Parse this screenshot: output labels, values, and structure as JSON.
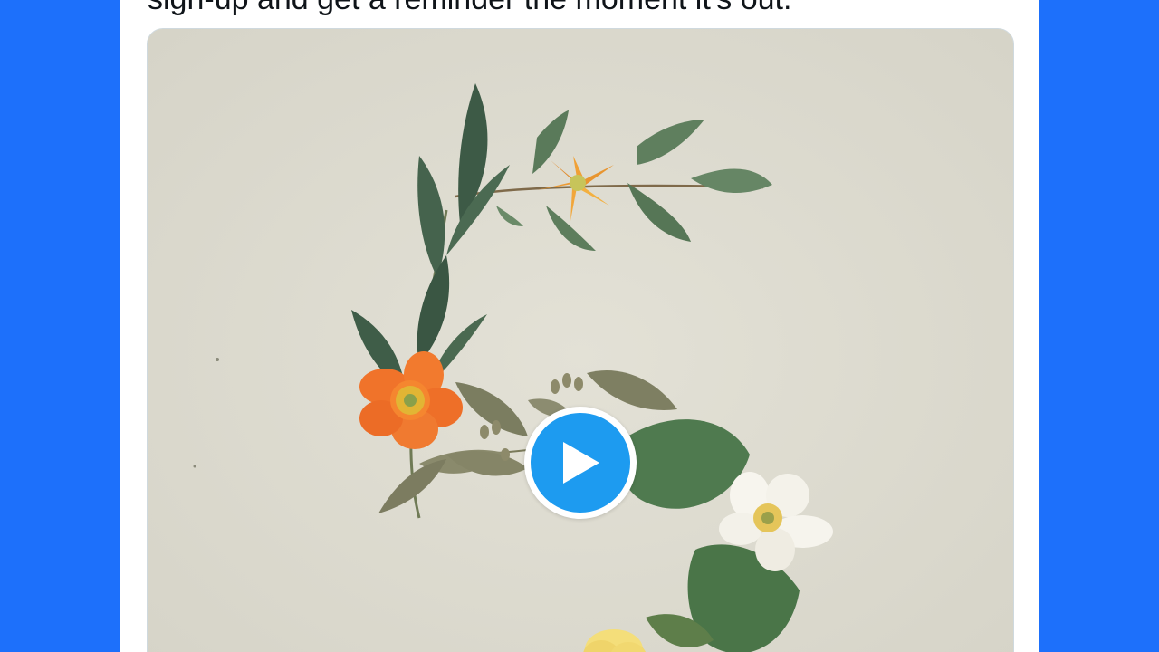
{
  "tweet": {
    "text": "sign-up and get a reminder the moment it's out:"
  },
  "media": {
    "type": "video",
    "play_icon": "play-icon",
    "play_color": "#1d9bf0",
    "background_color": "#dedcd0"
  },
  "colors": {
    "page_background": "#1d70fb",
    "card_background": "#ffffff"
  }
}
